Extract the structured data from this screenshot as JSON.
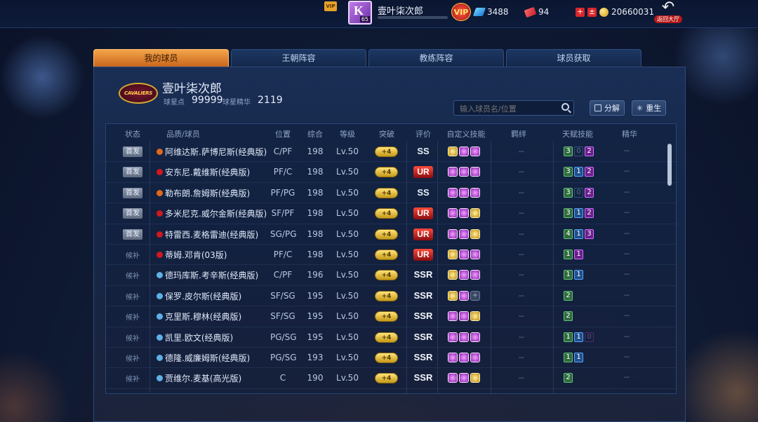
{
  "top": {
    "player_name": "壹叶柒次郎",
    "avatar_level": "65",
    "avatar_letter": "K",
    "vip_label": "VIP",
    "gems": "3488",
    "tickets": "94",
    "gold": "20660031",
    "return_label": "返回大厅"
  },
  "tabs": [
    {
      "label": "我的球员",
      "active": true
    },
    {
      "label": "王朝阵容",
      "active": false
    },
    {
      "label": "教练阵容",
      "active": false
    },
    {
      "label": "球员获取",
      "active": false
    }
  ],
  "owner": {
    "name": "壹叶柒次郎",
    "team_logo_text": "CAVALIERS",
    "star_points_label": "球星点",
    "star_points": "99999",
    "essence_label": "球星精华",
    "essence": "2119"
  },
  "search": {
    "placeholder": "输入球员名/位置"
  },
  "actions": {
    "decompose": "分解",
    "rebirth": "重生"
  },
  "columns": [
    "状态",
    "品质/球员",
    "位置",
    "综合",
    "等级",
    "突破",
    "评价",
    "自定义技能",
    "羁绊",
    "天赋技能",
    "精华"
  ],
  "colors": {
    "accent": "#e8902f",
    "panel": "#152748",
    "ur": "#d0181e"
  },
  "rows": [
    {
      "status": "首发",
      "starter": true,
      "dot": "#e0681e",
      "name": "阿维达斯.萨博尼斯(经典版)",
      "pos": "C/PF",
      "ovr": "198",
      "lvl": "Lv.50",
      "brk": "+4",
      "rating": "SS",
      "skills": [
        "g",
        "p",
        "p"
      ],
      "bond": "--",
      "talent": [
        [
          "3",
          "gr"
        ],
        [
          "0",
          "dim-bl"
        ],
        [
          "2",
          "pu"
        ]
      ],
      "essence": "--"
    },
    {
      "status": "首发",
      "starter": true,
      "dot": "#d0181e",
      "name": "安东尼.戴维斯(经典版)",
      "pos": "PF/C",
      "ovr": "198",
      "lvl": "Lv.50",
      "brk": "+4",
      "rating": "UR",
      "skills": [
        "p",
        "p",
        "p"
      ],
      "bond": "--",
      "talent": [
        [
          "3",
          "gr"
        ],
        [
          "1",
          "bl"
        ],
        [
          "2",
          "pu"
        ]
      ],
      "essence": "--"
    },
    {
      "status": "首发",
      "starter": true,
      "dot": "#e0681e",
      "name": "勒布朗.詹姆斯(经典版)",
      "pos": "PF/PG",
      "ovr": "198",
      "lvl": "Lv.50",
      "brk": "+4",
      "rating": "SS",
      "skills": [
        "p",
        "p",
        "p"
      ],
      "bond": "--",
      "talent": [
        [
          "3",
          "gr"
        ],
        [
          "0",
          "dim-bl"
        ],
        [
          "2",
          "pu"
        ]
      ],
      "essence": "--"
    },
    {
      "status": "首发",
      "starter": true,
      "dot": "#d0181e",
      "name": "多米尼克.威尔金斯(经典版)",
      "pos": "SF/PF",
      "ovr": "198",
      "lvl": "Lv.50",
      "brk": "+4",
      "rating": "UR",
      "skills": [
        "p",
        "p",
        "g"
      ],
      "bond": "--",
      "talent": [
        [
          "3",
          "gr"
        ],
        [
          "1",
          "bl"
        ],
        [
          "2",
          "pu"
        ]
      ],
      "essence": "--"
    },
    {
      "status": "首发",
      "starter": true,
      "dot": "#d0181e",
      "name": "特雷西.麦格雷迪(经典版)",
      "pos": "SG/PG",
      "ovr": "198",
      "lvl": "Lv.50",
      "brk": "+4",
      "rating": "UR",
      "skills": [
        "p",
        "p",
        "g"
      ],
      "bond": "--",
      "talent": [
        [
          "4",
          "gr"
        ],
        [
          "1",
          "bl"
        ],
        [
          "3",
          "pu"
        ]
      ],
      "essence": "--"
    },
    {
      "status": "候补",
      "starter": false,
      "dot": "#d0181e",
      "name": "蒂姆.邓肯(03版)",
      "pos": "PF/C",
      "ovr": "198",
      "lvl": "Lv.50",
      "brk": "+4",
      "rating": "UR",
      "skills": [
        "g",
        "p",
        "p"
      ],
      "bond": "--",
      "talent": [
        [
          "1",
          "gr"
        ],
        [
          "1",
          "pu"
        ]
      ],
      "essence": "--"
    },
    {
      "status": "候补",
      "starter": false,
      "dot": "#5fb0e8",
      "name": "德玛库斯.考辛斯(经典版)",
      "pos": "C/PF",
      "ovr": "196",
      "lvl": "Lv.50",
      "brk": "+4",
      "rating": "SSR",
      "skills": [
        "g",
        "p",
        "p"
      ],
      "bond": "--",
      "talent": [
        [
          "1",
          "gr"
        ],
        [
          "1",
          "bl"
        ]
      ],
      "essence": "--"
    },
    {
      "status": "候补",
      "starter": false,
      "dot": "#5fb0e8",
      "name": "保罗.皮尔斯(经典版)",
      "pos": "SF/SG",
      "ovr": "195",
      "lvl": "Lv.50",
      "brk": "+4",
      "rating": "SSR",
      "skills": [
        "g",
        "p",
        "e"
      ],
      "bond": "--",
      "talent": [
        [
          "2",
          "gr"
        ]
      ],
      "essence": "--"
    },
    {
      "status": "候补",
      "starter": false,
      "dot": "#5fb0e8",
      "name": "克里斯.穆林(经典版)",
      "pos": "SF/SG",
      "ovr": "195",
      "lvl": "Lv.50",
      "brk": "+4",
      "rating": "SSR",
      "skills": [
        "p",
        "p",
        "g"
      ],
      "bond": "--",
      "talent": [
        [
          "2",
          "gr"
        ]
      ],
      "essence": "--"
    },
    {
      "status": "候补",
      "starter": false,
      "dot": "#5fb0e8",
      "name": "凯里.欧文(经典版)",
      "pos": "PG/SG",
      "ovr": "195",
      "lvl": "Lv.50",
      "brk": "+4",
      "rating": "SSR",
      "skills": [
        "p",
        "p",
        "p"
      ],
      "bond": "--",
      "talent": [
        [
          "1",
          "gr"
        ],
        [
          "1",
          "bl"
        ],
        [
          "0",
          "dim-pu"
        ]
      ],
      "essence": "--"
    },
    {
      "status": "候补",
      "starter": false,
      "dot": "#5fb0e8",
      "name": "德隆.威廉姆斯(经典版)",
      "pos": "PG/SG",
      "ovr": "193",
      "lvl": "Lv.50",
      "brk": "+4",
      "rating": "SSR",
      "skills": [
        "p",
        "p",
        "p"
      ],
      "bond": "--",
      "talent": [
        [
          "1",
          "gr"
        ],
        [
          "1",
          "bl"
        ]
      ],
      "essence": "--"
    },
    {
      "status": "候补",
      "starter": false,
      "dot": "#5fb0e8",
      "name": "贾维尔.麦基(高光版)",
      "pos": "C",
      "ovr": "190",
      "lvl": "Lv.50",
      "brk": "+4",
      "rating": "SSR",
      "skills": [
        "p",
        "p",
        "g"
      ],
      "bond": "--",
      "talent": [
        [
          "2",
          "gr"
        ]
      ],
      "essence": "--"
    }
  ]
}
